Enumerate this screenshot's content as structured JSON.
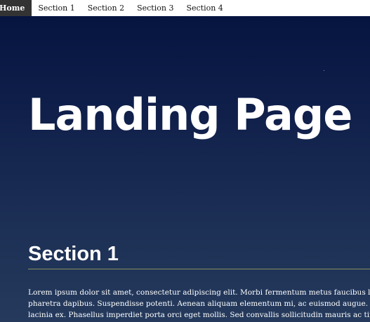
{
  "nav": {
    "items": [
      {
        "label": "Home",
        "active": true
      },
      {
        "label": "Section 1",
        "active": false
      },
      {
        "label": "Section 2",
        "active": false
      },
      {
        "label": "Section 3",
        "active": false
      },
      {
        "label": "Section 4",
        "active": false
      }
    ]
  },
  "hero": {
    "title": "Landing Page"
  },
  "section1": {
    "heading": "Section 1",
    "lines": [
      "Lorem ipsum dolor sit amet, consectetur adipiscing elit. Morbi fermentum metus faucibus lectus",
      "pharetra dapibus. Suspendisse potenti. Aenean aliquam elementum mi, ac euismod augue. Donec eget",
      "lacinia ex. Phasellus imperdiet porta orci eget mollis. Sed convallis sollicitudin mauris ac tincidunt."
    ]
  },
  "colors": {
    "nav_background": "#ffffff",
    "nav_active_background": "#333333",
    "hero_gradient_top": "#061440",
    "hero_gradient_bottom": "#253a5c",
    "section_rule": "#8a8f5c",
    "text": "#ffffff"
  }
}
